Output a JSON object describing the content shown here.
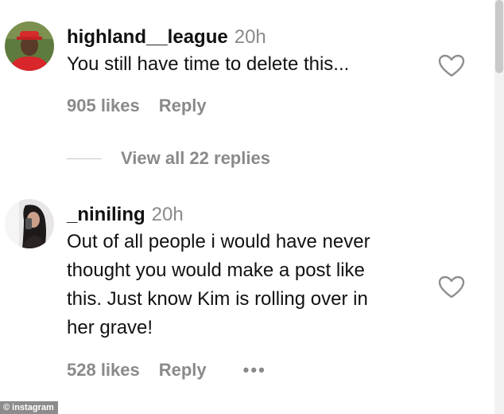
{
  "comments": [
    {
      "username": "highland__league",
      "time": "20h",
      "lines": [
        "You still have time to delete this..."
      ],
      "likes": "905 likes",
      "reply_label": "Reply",
      "like_icon": "heart-outline-icon"
    },
    {
      "username": "_niniling",
      "time": "20h",
      "lines": [
        "Out of all people i would have never",
        "thought you would make a post like",
        "this. Just know Kim is rolling over in",
        "her grave!"
      ],
      "likes": "528 likes",
      "reply_label": "Reply",
      "more_label": "•••",
      "like_icon": "heart-outline-icon"
    }
  ],
  "view_replies": "View all 22 replies",
  "watermark": "© instagram"
}
